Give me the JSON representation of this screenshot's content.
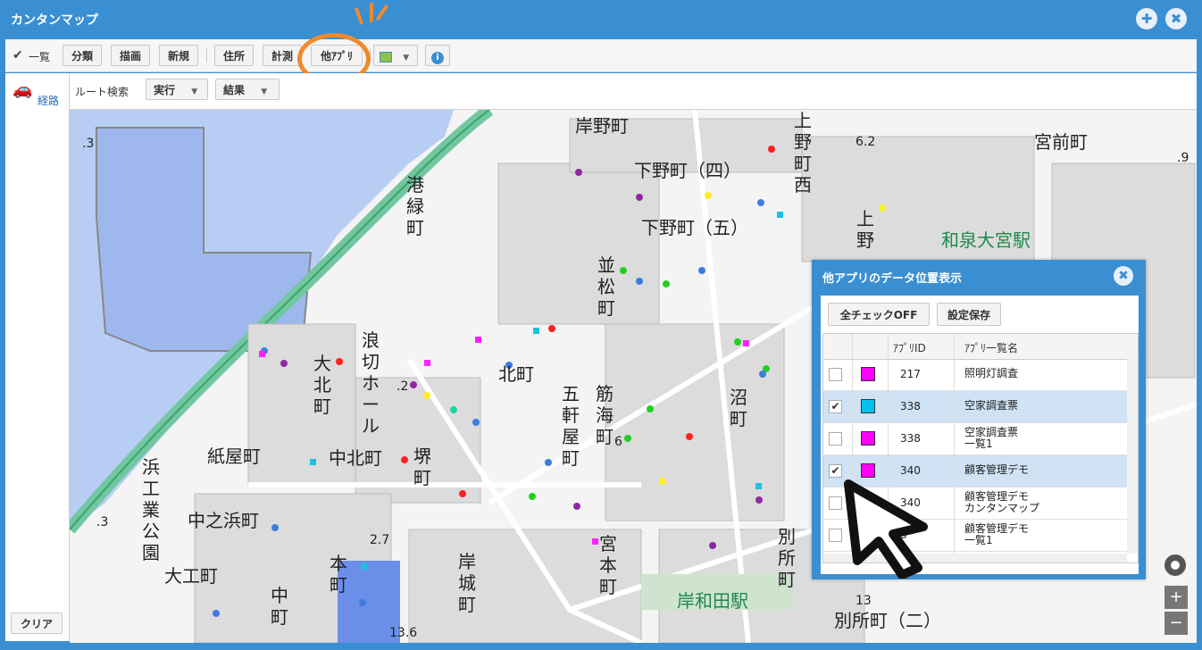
{
  "app": {
    "title": "カンタンマップ",
    "add_icon": "✚",
    "close_icon": "✖"
  },
  "toolbar": {
    "list_label": "一覧",
    "category": "分類",
    "draw": "描画",
    "new": "新規",
    "address": "住所",
    "measure": "計測",
    "other_apps": "他ｱﾌﾟﾘ",
    "info": "i",
    "dropdown_icon": "▼"
  },
  "route": {
    "side_label": "経路",
    "search_label": "ルート検索",
    "run": "実行",
    "result": "結果",
    "clear": "クリア"
  },
  "map": {
    "labels": [
      "岸野町",
      "下野町（四）",
      "下野町（五）",
      "宮前町",
      "上野町西",
      "上野",
      "和泉大宮駅",
      "港緑町",
      "並松町",
      "浪切ホール",
      "大北町",
      "北町",
      "五軒屋町",
      "筋海町",
      "沼町",
      "紙屋町",
      "中北町",
      "堺町",
      "浜工業公園",
      "中之浜町",
      "大工町",
      "本町",
      "中町",
      "岸城町",
      "宮本町",
      "別所町",
      "岸和田駅",
      "別所町（二）"
    ],
    "numbers": [
      ".3",
      ".9",
      ".3",
      "6.2",
      ".2",
      "6",
      "2.7",
      "13",
      "13.6"
    ]
  },
  "panel": {
    "title": "他アプリのデータ位置表示",
    "check_off": "全チェックOFF",
    "save": "設定保存",
    "col_id": "ｱﾌﾟﾘID",
    "col_name": "ｱﾌﾟﾘ一覧名",
    "rows": [
      {
        "checked": false,
        "color": "#ff00ff",
        "id": "217",
        "name": "照明灯調査"
      },
      {
        "checked": true,
        "color": "#00c0f0",
        "id": "338",
        "name": "空家調査票"
      },
      {
        "checked": false,
        "color": "#ff00ff",
        "id": "338",
        "name": "空家調査票\n一覧1"
      },
      {
        "checked": true,
        "color": "#ff00ff",
        "id": "340",
        "name": "顧客管理デモ"
      },
      {
        "checked": false,
        "color": "#f5a000",
        "id": "340",
        "name": "顧客管理デモ\nカンタンマップ"
      },
      {
        "checked": false,
        "color": "#ff00ff",
        "id": "3",
        "name": "顧客管理デモ\n一覧1"
      }
    ]
  }
}
